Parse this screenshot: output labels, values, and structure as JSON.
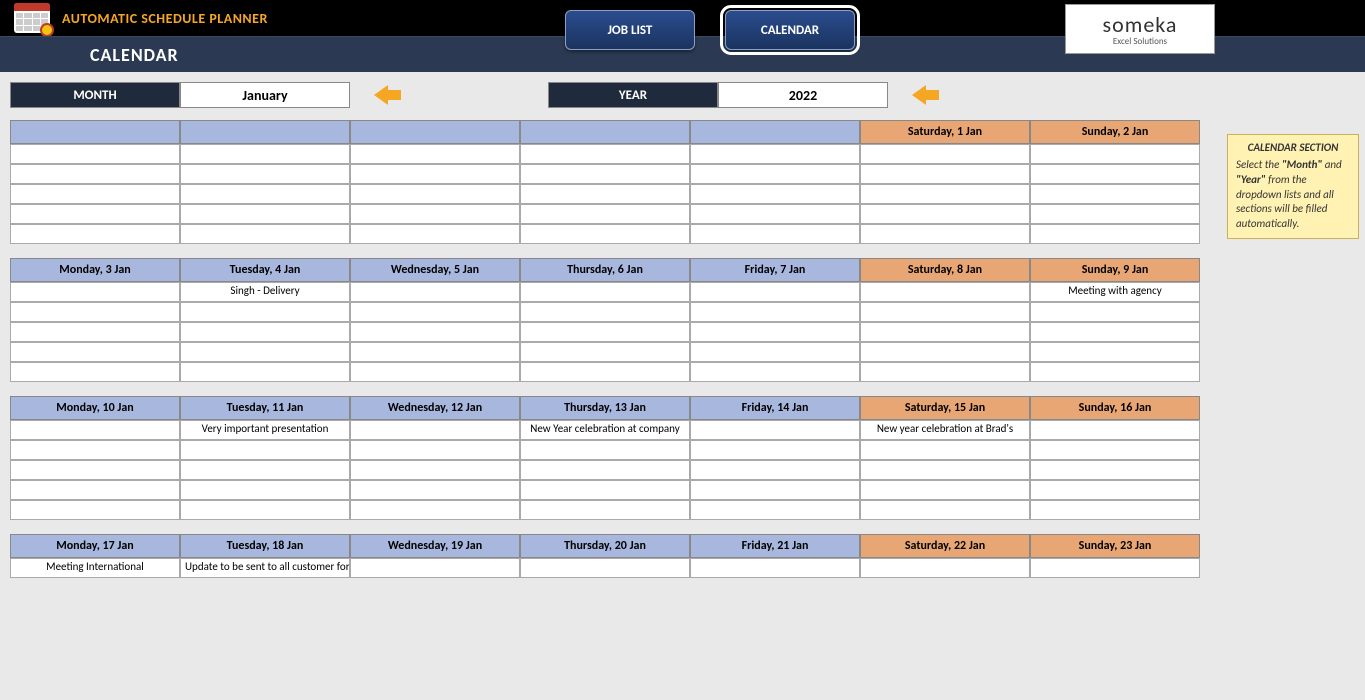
{
  "header": {
    "app_title": "AUTOMATIC SCHEDULE PLANNER",
    "sub_title": "CALENDAR",
    "nav": {
      "job_list": "JOB LIST",
      "calendar": "CALENDAR"
    },
    "logo": {
      "big": "someka",
      "small": "Excel Solutions"
    }
  },
  "controls": {
    "month_label": "MONTH",
    "month_value": "January",
    "year_label": "YEAR",
    "year_value": "2022"
  },
  "help": {
    "title": "CALENDAR SECTION",
    "l1": "Select the ",
    "b1": "\"Month\"",
    "l2": " and ",
    "b2": "\"Year\"",
    "l3": " from the dropdown lists and all sections will be filled automatically."
  },
  "weeks": [
    {
      "headers": [
        "",
        "",
        "",
        "",
        "",
        "Saturday, 1 Jan",
        "Sunday, 2 Jan"
      ],
      "weekend_flags": [
        false,
        false,
        false,
        false,
        false,
        true,
        true
      ],
      "rows": [
        [
          "",
          "",
          "",
          "",
          "",
          "",
          ""
        ],
        [
          "",
          "",
          "",
          "",
          "",
          "",
          ""
        ],
        [
          "",
          "",
          "",
          "",
          "",
          "",
          ""
        ],
        [
          "",
          "",
          "",
          "",
          "",
          "",
          ""
        ],
        [
          "",
          "",
          "",
          "",
          "",
          "",
          ""
        ]
      ]
    },
    {
      "headers": [
        "Monday, 3 Jan",
        "Tuesday, 4 Jan",
        "Wednesday, 5 Jan",
        "Thursday, 6 Jan",
        "Friday, 7 Jan",
        "Saturday, 8 Jan",
        "Sunday, 9 Jan"
      ],
      "weekend_flags": [
        false,
        false,
        false,
        false,
        false,
        true,
        true
      ],
      "rows": [
        [
          "",
          "Singh - Delivery",
          "",
          "",
          "",
          "",
          "Meeting with agency"
        ],
        [
          "",
          "",
          "",
          "",
          "",
          "",
          ""
        ],
        [
          "",
          "",
          "",
          "",
          "",
          "",
          ""
        ],
        [
          "",
          "",
          "",
          "",
          "",
          "",
          ""
        ],
        [
          "",
          "",
          "",
          "",
          "",
          "",
          ""
        ]
      ]
    },
    {
      "headers": [
        "Monday, 10 Jan",
        "Tuesday, 11 Jan",
        "Wednesday, 12 Jan",
        "Thursday, 13 Jan",
        "Friday, 14 Jan",
        "Saturday, 15 Jan",
        "Sunday, 16 Jan"
      ],
      "weekend_flags": [
        false,
        false,
        false,
        false,
        false,
        true,
        true
      ],
      "rows": [
        [
          "",
          "Very important presentation",
          "",
          "New Year celebration at company",
          "",
          "New year celebration at Brad's",
          ""
        ],
        [
          "",
          "",
          "",
          "",
          "",
          "",
          ""
        ],
        [
          "",
          "",
          "",
          "",
          "",
          "",
          ""
        ],
        [
          "",
          "",
          "",
          "",
          "",
          "",
          ""
        ],
        [
          "",
          "",
          "",
          "",
          "",
          "",
          ""
        ]
      ]
    },
    {
      "headers": [
        "Monday, 17 Jan",
        "Tuesday, 18 Jan",
        "Wednesday, 19 Jan",
        "Thursday, 20 Jan",
        "Friday, 21 Jan",
        "Saturday, 22 Jan",
        "Sunday, 23 Jan"
      ],
      "weekend_flags": [
        false,
        false,
        false,
        false,
        false,
        true,
        true
      ],
      "rows": [
        [
          "Meeting International",
          "Update to be sent to all customer for th",
          "",
          "",
          "",
          "",
          ""
        ]
      ]
    }
  ]
}
